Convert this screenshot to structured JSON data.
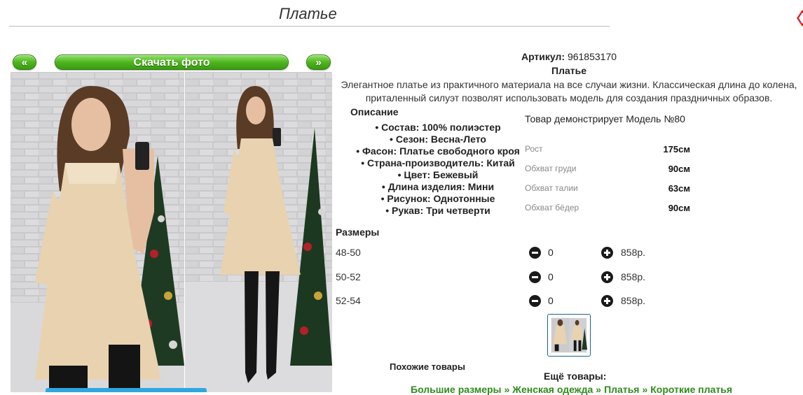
{
  "page": {
    "title": "Платье"
  },
  "gallery": {
    "prev_label": "«",
    "download_label": "Скачать фото",
    "next_label": "»"
  },
  "product": {
    "article_label": "Артикул:",
    "article_value": "961853170",
    "name": "Платье",
    "description": "Элегантное платье из практичного материала на все случаи жизни. Классическая длина до колена, приталенный силуэт позволят использовать модель для создания праздничных образов.",
    "description_heading": "Описание",
    "attributes": [
      "Состав: 100% полиэстер",
      "Сезон: Весна-Лето",
      "Фасон: Платье свободного кроя",
      "Страна-производитель: Китай",
      "Цвет: Бежевый",
      "Длина изделия: Мини",
      "Рисунок: Однотонные",
      "Рукав: Три четверти"
    ]
  },
  "model": {
    "caption": "Товар демонстрирует Модель №80",
    "measurements": [
      {
        "label": "Рост",
        "value": "175см"
      },
      {
        "label": "Обхват груди",
        "value": "90см"
      },
      {
        "label": "Обхват талии",
        "value": "63см"
      },
      {
        "label": "Обхват бёдер",
        "value": "90см"
      }
    ]
  },
  "sizes": {
    "heading": "Размеры",
    "rows": [
      {
        "size": "48-50",
        "qty": "0",
        "price": "858р."
      },
      {
        "size": "50-52",
        "qty": "0",
        "price": "858р."
      },
      {
        "size": "52-54",
        "qty": "0",
        "price": "858р."
      }
    ]
  },
  "footer": {
    "similar_heading": "Похожие товары",
    "more_heading": "Ещё товары:",
    "breadcrumb": [
      "Большие размеры",
      "Женская одежда",
      "Платья",
      "Короткие платья"
    ],
    "separator": "»"
  },
  "colors": {
    "button_green": "#4fb51e",
    "link_green": "#2e8b1b",
    "dress_beige": "#e9d2b0",
    "corner_red": "#d8262d"
  },
  "icons": {
    "corner": "red-diamond-icon",
    "minus": "minus-circle-icon",
    "plus": "plus-circle-icon"
  }
}
